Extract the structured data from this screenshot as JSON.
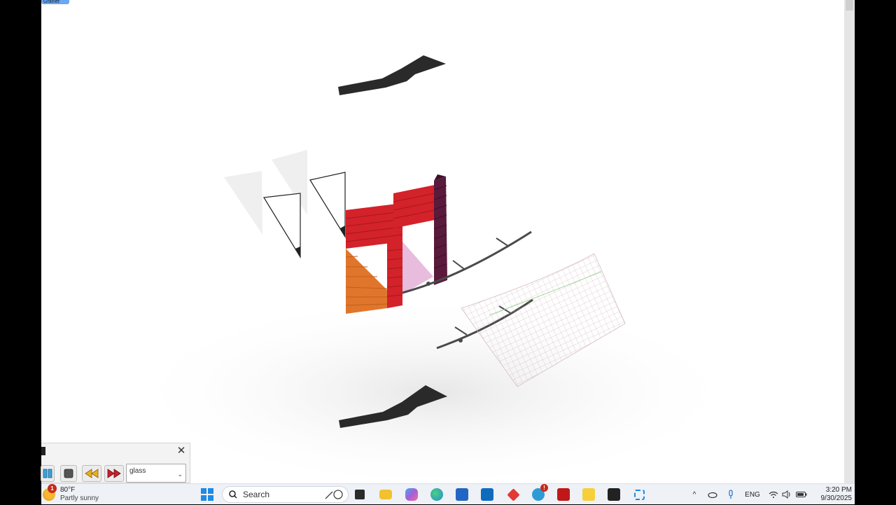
{
  "viewport": {
    "tag_label": "Grainer"
  },
  "animation_panel": {
    "material_value": "glass",
    "buttons": [
      "play-pause",
      "stop",
      "rewind",
      "fast-forward"
    ]
  },
  "taskbar": {
    "weather": {
      "badge": "1",
      "temperature": "80°F",
      "condition": "Partly sunny"
    },
    "search_label": "Search",
    "apps": [
      {
        "name": "task-view",
        "color": "#2b2b2b"
      },
      {
        "name": "file-explorer",
        "color": "#f2c12e"
      },
      {
        "name": "copilot",
        "color": "#8a63d2"
      },
      {
        "name": "edge",
        "color": "#1f8fd6"
      },
      {
        "name": "microsoft-store",
        "color": "#2266c4"
      },
      {
        "name": "outlook",
        "color": "#0f6cbd"
      },
      {
        "name": "red-diamond-app",
        "color": "#e53935"
      },
      {
        "name": "help-app",
        "color": "#2e9bd6",
        "badge": "!"
      },
      {
        "name": "mcafee",
        "color": "#c01818"
      },
      {
        "name": "sticky-notes",
        "color": "#f5d03b"
      },
      {
        "name": "rhino",
        "color": "#222222"
      },
      {
        "name": "snipping-tool",
        "color": "#1e88e5"
      }
    ],
    "tray": {
      "language": "ENG",
      "time": "3:20 PM",
      "date": "9/30/2025"
    }
  },
  "scene": {
    "colors": {
      "red": "#d3222a",
      "orange": "#e0762c",
      "purple": "#5a1a3c",
      "pink": "#d98fc4",
      "dark": "#2a2a2a"
    }
  }
}
